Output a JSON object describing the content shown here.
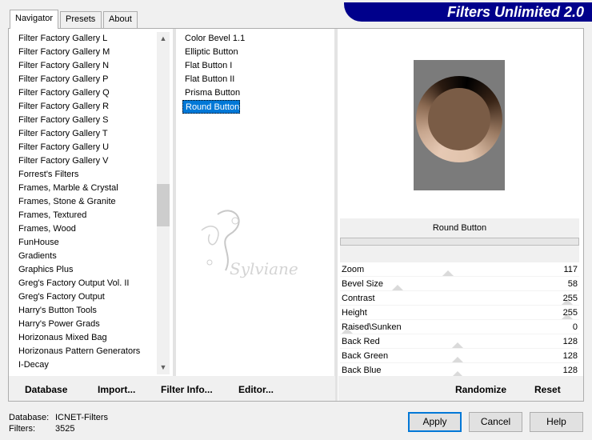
{
  "tabs": [
    "Navigator",
    "Presets",
    "About"
  ],
  "app_title": "Filters Unlimited 2.0",
  "categories": [
    "Filter Factory Gallery L",
    "Filter Factory Gallery M",
    "Filter Factory Gallery N",
    "Filter Factory Gallery P",
    "Filter Factory Gallery Q",
    "Filter Factory Gallery R",
    "Filter Factory Gallery S",
    "Filter Factory Gallery T",
    "Filter Factory Gallery U",
    "Filter Factory Gallery V",
    "Forrest's Filters",
    "Frames, Marble & Crystal",
    "Frames, Stone & Granite",
    "Frames, Textured",
    "Frames, Wood",
    "FunHouse",
    "Gradients",
    "Graphics Plus",
    "Greg's Factory Output Vol. II",
    "Greg's Factory Output",
    "Harry's Button Tools",
    "Harry's Power Grads",
    "Horizonaus Mixed Bag",
    "Horizonaus Pattern Generators",
    "I-Decay"
  ],
  "filters": [
    "Color Bevel 1.1",
    "Elliptic Button",
    "Flat Button I",
    "Flat Button II",
    "Prisma Button",
    "Round Button"
  ],
  "selected_filter_index": 5,
  "preview_title": "Round Button",
  "watermark_text": "Sylviane",
  "params": [
    {
      "name": "Zoom",
      "value": "117",
      "level": 117
    },
    {
      "name": "Bevel Size",
      "value": "58",
      "level": 58
    },
    {
      "name": "Contrast",
      "value": "255",
      "level": 255
    },
    {
      "name": "Height",
      "value": "255",
      "level": 255
    },
    {
      "name": "Raised\\Sunken",
      "value": "0",
      "level": 0
    },
    {
      "name": "Back Red",
      "value": "128",
      "level": 128
    },
    {
      "name": "Back Green",
      "value": "128",
      "level": 128
    },
    {
      "name": "Back Blue",
      "value": "128",
      "level": 128
    }
  ],
  "toolbar": {
    "database": "Database",
    "import": "Import...",
    "filter_info": "Filter Info...",
    "editor": "Editor..."
  },
  "randomize": "Randomize",
  "reset": "Reset",
  "status": {
    "database_label": "Database:",
    "database_value": "ICNET-Filters",
    "filters_label": "Filters:",
    "filters_value": "3525"
  },
  "buttons": {
    "apply": "Apply",
    "cancel": "Cancel",
    "help": "Help"
  },
  "colors": {
    "banner": "#00008b",
    "selection": "#0078d7",
    "preview_bg": "#7b7b7b"
  }
}
